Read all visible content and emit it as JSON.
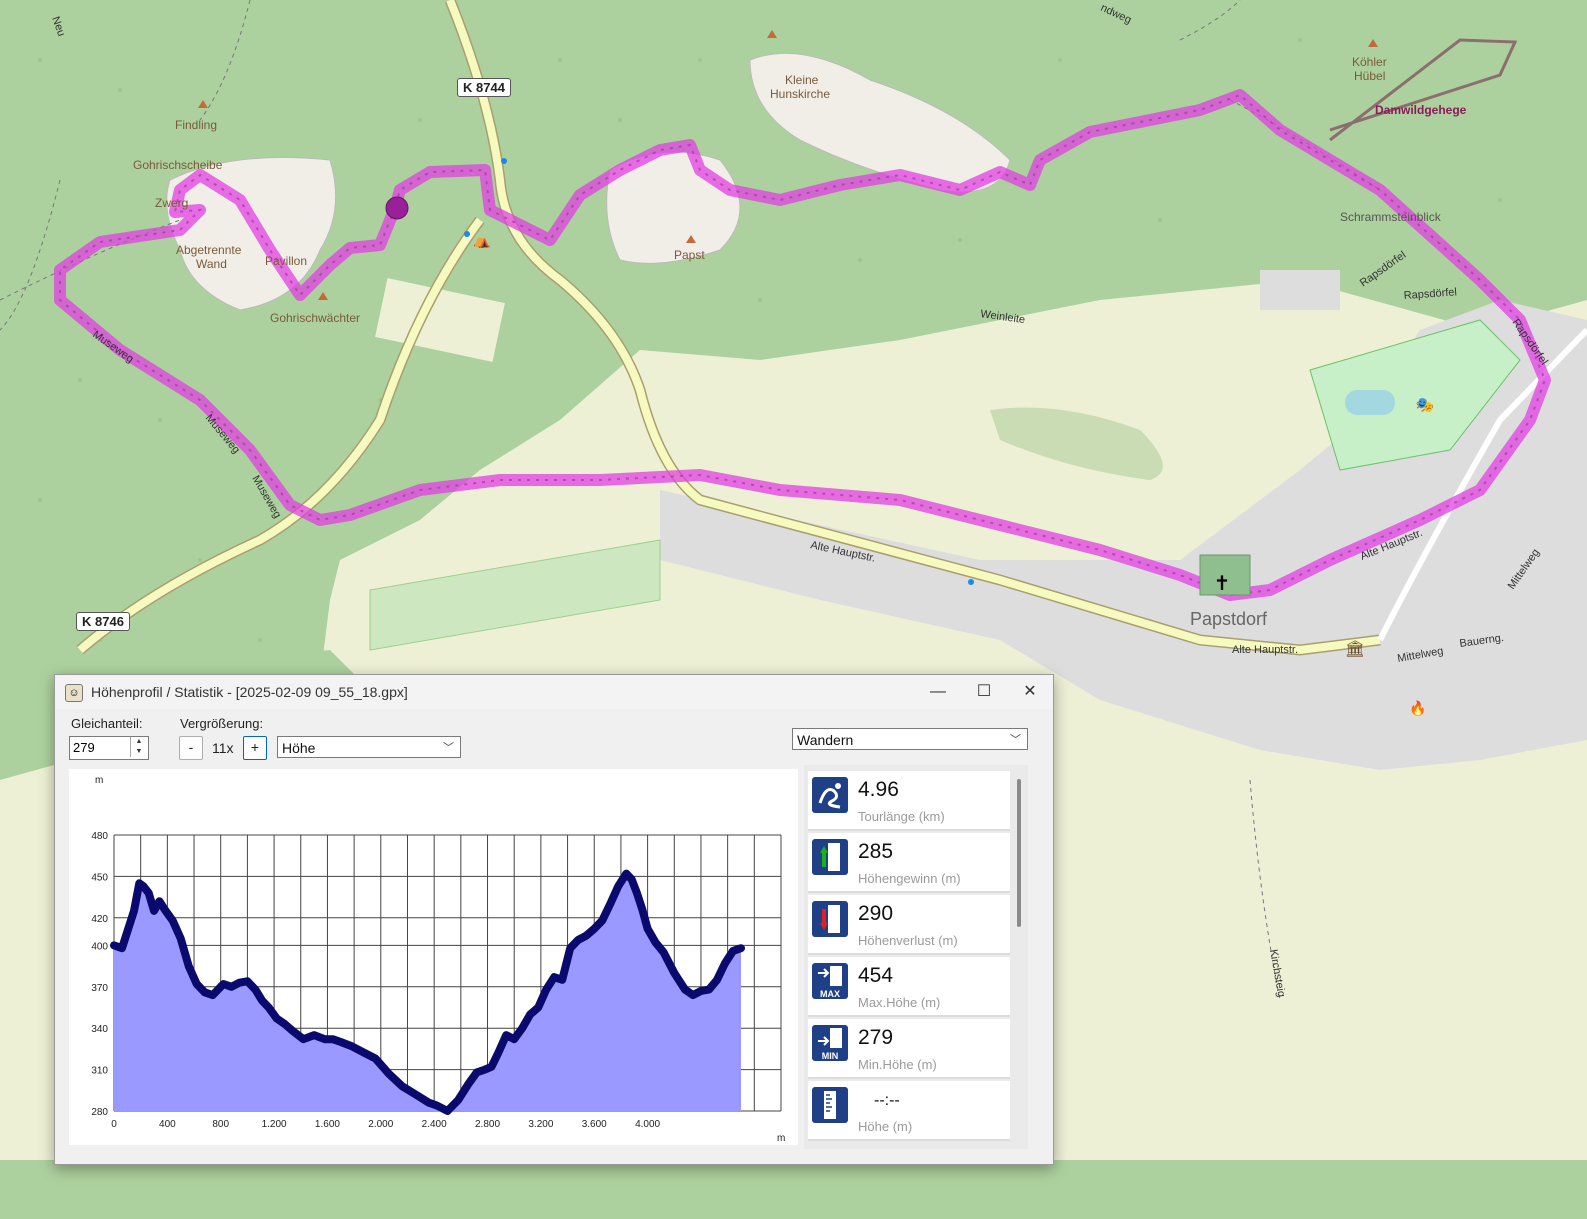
{
  "map": {
    "roads": [
      {
        "label": "K 8744"
      },
      {
        "label": "K 8746"
      }
    ],
    "places": [
      {
        "label": "Findling"
      },
      {
        "label": "Gohrischscheibe"
      },
      {
        "label": "Zwerg"
      },
      {
        "label": "Abgetrennte"
      },
      {
        "label": "Wand"
      },
      {
        "label": "Pavillon"
      },
      {
        "label": "Gohrischwächter"
      },
      {
        "label": "Kleine"
      },
      {
        "label": "Hunskirche"
      },
      {
        "label": "Papst"
      },
      {
        "label": "Köhler"
      },
      {
        "label": "Hübel"
      },
      {
        "label": "Damwildgehege"
      },
      {
        "label": "Schrammsteinblick"
      },
      {
        "label": "Papstdorf"
      },
      {
        "label": "Rapsdörfel"
      },
      {
        "label": "Rapsdörfel"
      },
      {
        "label": "Rapsdörfel"
      },
      {
        "label": "Weinleite"
      },
      {
        "label": "Alte Hauptstr."
      },
      {
        "label": "Alte Hauptstr."
      },
      {
        "label": "Alte Hauptstr."
      },
      {
        "label": "Museweg"
      },
      {
        "label": "Museweg"
      },
      {
        "label": "Museweg"
      },
      {
        "label": "Mittelweg"
      },
      {
        "label": "Mittelweg"
      },
      {
        "label": "Bauerng."
      },
      {
        "label": "Kirchsteig"
      },
      {
        "label": "Neu"
      },
      {
        "label": "ndweg"
      }
    ],
    "colors": {
      "track": "#e040e0",
      "forest": "#add19e",
      "field": "#eef0d5",
      "residential": "#dddddd",
      "road": "#f7fabf"
    }
  },
  "window": {
    "title": "Höhenprofil / Statistik - [2025-02-09 09_55_18.gpx]",
    "controls": {
      "minimize": "—",
      "maximize": "☐",
      "close": "✕"
    },
    "offset_label": "Gleichanteil:",
    "offset_value": "279",
    "zoom_label": "Vergrößerung:",
    "zoom_minus": "-",
    "zoom_value": "11x",
    "zoom_plus": "+",
    "mode_select": "Höhe",
    "activity_select": "Wandern"
  },
  "chart_data": {
    "type": "area",
    "ylabel": "m",
    "xlabel": "m",
    "ylim": [
      280,
      480
    ],
    "xlim": [
      0,
      5000
    ],
    "x_tick_labels": [
      "0",
      "400",
      "800",
      "1.200",
      "1.600",
      "2.000",
      "2.400",
      "2.800",
      "3.200",
      "3.600",
      "4.000"
    ],
    "y_tick_labels": [
      "480",
      "450",
      "420",
      "400",
      "370",
      "340",
      "310",
      "280"
    ],
    "grid": true,
    "color": "#9999ff",
    "line_color": "#0a0a6e",
    "x": [
      0,
      60,
      100,
      150,
      190,
      220,
      260,
      300,
      340,
      380,
      440,
      500,
      560,
      620,
      680,
      740,
      820,
      880,
      940,
      1000,
      1060,
      1110,
      1160,
      1220,
      1280,
      1340,
      1420,
      1500,
      1580,
      1640,
      1700,
      1780,
      1860,
      1960,
      2060,
      2160,
      2260,
      2360,
      2420,
      2500,
      2580,
      2660,
      2720,
      2780,
      2830,
      2880,
      2940,
      3000,
      3060,
      3120,
      3180,
      3240,
      3300,
      3360,
      3420,
      3480,
      3540,
      3600,
      3660,
      3720,
      3780,
      3840,
      3880,
      3920,
      3960,
      4000,
      4060,
      4120,
      4200,
      4280,
      4340,
      4400,
      4460,
      4520,
      4580,
      4640,
      4700
    ],
    "y": [
      400,
      398,
      410,
      425,
      445,
      443,
      438,
      425,
      432,
      426,
      418,
      405,
      385,
      372,
      366,
      364,
      372,
      370,
      373,
      374,
      368,
      360,
      355,
      347,
      343,
      338,
      332,
      335,
      332,
      332,
      330,
      327,
      323,
      318,
      307,
      298,
      292,
      286,
      284,
      280,
      288,
      300,
      308,
      310,
      312,
      322,
      335,
      332,
      340,
      350,
      355,
      368,
      377,
      375,
      398,
      404,
      407,
      412,
      418,
      430,
      443,
      452,
      448,
      438,
      426,
      412,
      402,
      395,
      380,
      368,
      364,
      367,
      368,
      375,
      387,
      396,
      398
    ]
  },
  "stats": [
    {
      "value": "4.96",
      "desc": "Tourlänge (km)",
      "icon": "route-icon"
    },
    {
      "value": "285",
      "desc": "Höhengewinn (m)",
      "icon": "elevation-gain-icon"
    },
    {
      "value": "290",
      "desc": "Höhenverlust (m)",
      "icon": "elevation-loss-icon"
    },
    {
      "value": "454",
      "desc": "Max.Höhe (m)",
      "icon_text": "MAX",
      "icon": "max-height-icon"
    },
    {
      "value": "279",
      "desc": "Min.Höhe (m)",
      "icon_text": "MIN",
      "icon": "min-height-icon"
    },
    {
      "value": "--:--",
      "desc": "Höhe (m)",
      "icon": "height-icon"
    }
  ]
}
